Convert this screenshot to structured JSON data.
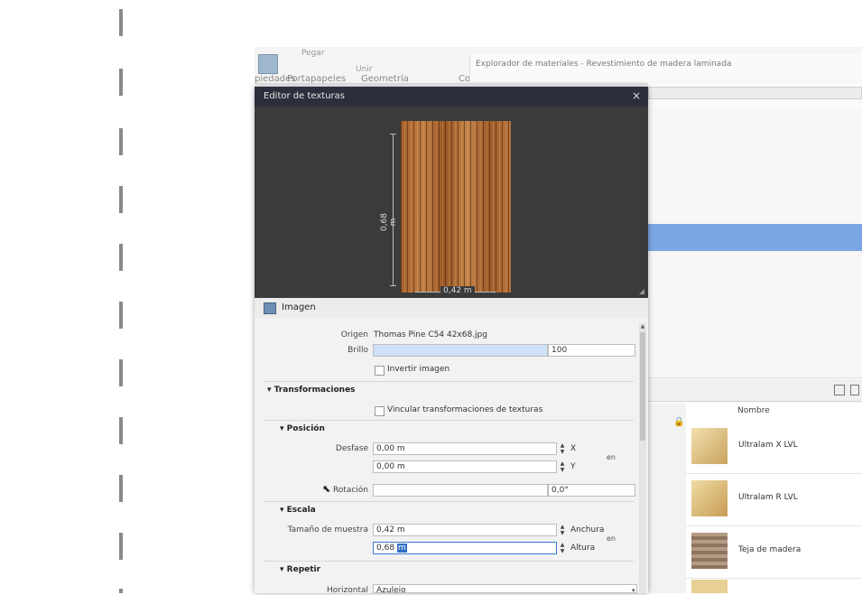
{
  "ribbon": {
    "item_1": "Pegar",
    "item_2": "Unir",
    "group_1": "piedades",
    "group_2": "Portapapeles",
    "group_3": "Geometría",
    "group_4": "Cor"
  },
  "browser_title": "Explorador de materiales - Revestimiento de madera laminada",
  "dialog": {
    "title": "Editor de texturas",
    "close": "×",
    "dim_vertical": "0,68 m",
    "dim_horizontal": "0,42 m",
    "image_section": "Imagen",
    "origin_label": "Origen",
    "origin_value": "Thomas Pine C54 42x68.jpg",
    "brightness_label": "Brillo",
    "brightness_value": "100",
    "brightness_level": 1.0,
    "invert_label": "Invertir imagen",
    "transforms_section": "Transformaciones",
    "link_label": "Vincular transformaciones de texturas",
    "position_section": "Posición",
    "offset_label": "Desfase",
    "offset_x": "0,00 m",
    "offset_y": "0,00 m",
    "axis_x": "X",
    "axis_y": "Y",
    "link_tag": "en",
    "rotation_label": "Rotación",
    "rotation_value": "0,0°",
    "scale_section": "Escala",
    "sample_size_label": "Tamaño de muestra",
    "width_value": "0,42 m",
    "height_value_num": "0,68",
    "height_value_unit": "m",
    "width_label": "Anchura",
    "height_label": "Altura",
    "repeat_section": "Repetir",
    "horizontal_label": "Horizontal",
    "horizontal_value": "Azulejo"
  },
  "library": {
    "column_header": "Nombre",
    "items": [
      {
        "name": "Ultralam X LVL"
      },
      {
        "name": "Ultralam R LVL"
      },
      {
        "name": "Teja de madera"
      }
    ]
  },
  "colors": {
    "dialog_title_bg": "#2b2f3b",
    "selection_blue": "#7aa6e4",
    "field_highlight": "#2f6fc4",
    "wood": "#b06b35"
  },
  "icons": [
    "close-icon",
    "image-icon",
    "lock-icon",
    "panel-icon",
    "list-icon",
    "checkbox-icon",
    "spin-icon",
    "dropdown-icon",
    "scroll-up-icon",
    "cursor-icon"
  ]
}
